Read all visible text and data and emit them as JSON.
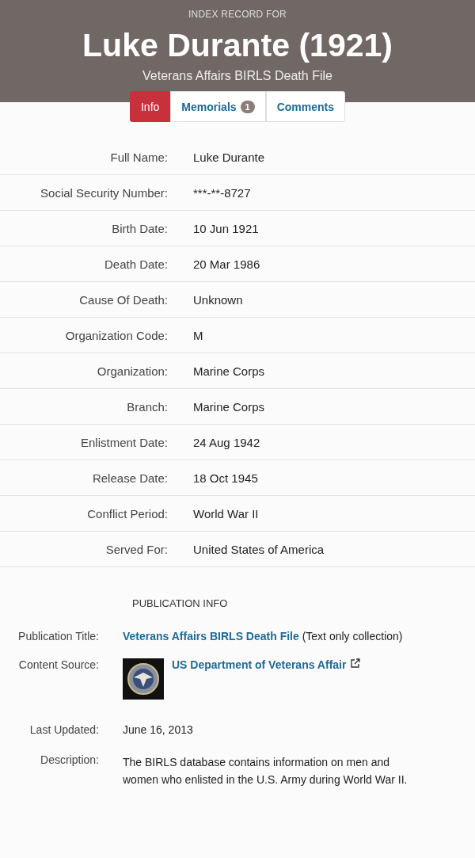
{
  "header": {
    "kicker": "INDEX RECORD FOR",
    "title": "Luke Durante (1921)",
    "subtitle": "Veterans Affairs BIRLS Death File"
  },
  "tabs": [
    {
      "label": "Info",
      "selected": true
    },
    {
      "label": "Memorials",
      "badge": "1",
      "selected": false
    },
    {
      "label": "Comments",
      "selected": false
    }
  ],
  "fields": [
    {
      "label": "Full Name:",
      "value": "Luke Durante"
    },
    {
      "label": "Social Security Number:",
      "value": "***-**-8727"
    },
    {
      "label": "Birth Date:",
      "value": "10 Jun 1921"
    },
    {
      "label": "Death Date:",
      "value": "20 Mar 1986"
    },
    {
      "label": "Cause Of Death:",
      "value": "Unknown"
    },
    {
      "label": "Organization Code:",
      "value": "M"
    },
    {
      "label": "Organization:",
      "value": "Marine Corps"
    },
    {
      "label": "Branch:",
      "value": "Marine Corps"
    },
    {
      "label": "Enlistment Date:",
      "value": "24 Aug 1942"
    },
    {
      "label": "Release Date:",
      "value": "18 Oct 1945"
    },
    {
      "label": "Conflict Period:",
      "value": "World War II"
    },
    {
      "label": "Served For:",
      "value": "United States of America"
    }
  ],
  "publication": {
    "heading": "PUBLICATION INFO",
    "title": {
      "label": "Publication Title:",
      "link": "Veterans Affairs BIRLS Death File",
      "note": "(Text only collection)"
    },
    "source": {
      "label": "Content Source:",
      "link": "US Department of Veterans Affair"
    },
    "updated": {
      "label": "Last Updated:",
      "value": "June 16, 2013"
    },
    "description": {
      "label": "Description:",
      "value": "The BIRLS database contains information on men and women who enlisted in the U.S. Army during World War II."
    }
  }
}
